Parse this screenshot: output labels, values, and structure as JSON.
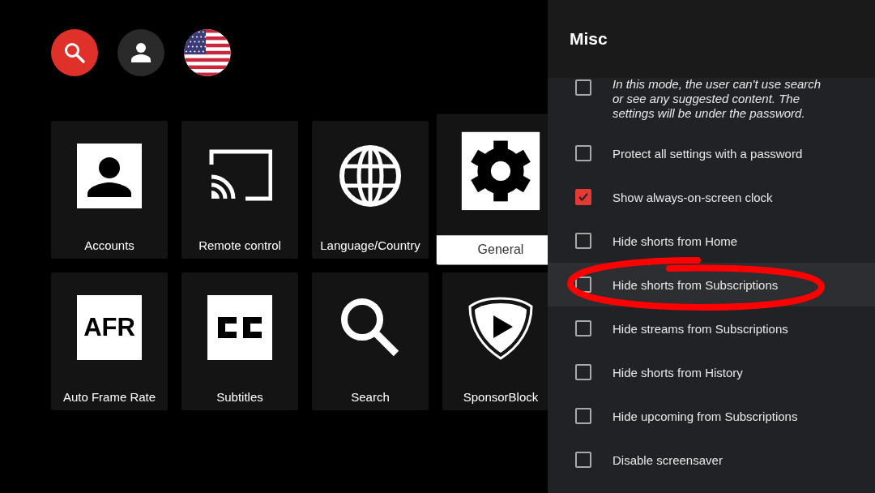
{
  "top_buttons": [
    {
      "kind": "search"
    },
    {
      "kind": "account"
    },
    {
      "kind": "flag"
    }
  ],
  "tiles": [
    {
      "label": "Accounts",
      "selected": false
    },
    {
      "label": "Remote control",
      "selected": false
    },
    {
      "label": "Language/Country",
      "selected": false
    },
    {
      "label": "General",
      "selected": true
    },
    {
      "label": "Auto Frame Rate",
      "badge": "AFR",
      "selected": false
    },
    {
      "label": "Subtitles",
      "selected": false
    },
    {
      "label": "Search",
      "selected": false
    },
    {
      "label": "SponsorBlock",
      "selected": false
    }
  ],
  "panel": {
    "title": "Misc",
    "items": [
      {
        "label": "In this mode, the user can't use search or see any suggested content. The settings will be under the password.",
        "kind": "description",
        "checked": false,
        "focused": false,
        "circled": false
      },
      {
        "label": "Protect all settings with a password",
        "checked": false,
        "focused": false,
        "circled": false
      },
      {
        "label": "Show always-on-screen clock",
        "checked": true,
        "focused": false,
        "circled": false
      },
      {
        "label": "Hide shorts from Home",
        "checked": false,
        "focused": false,
        "circled": false
      },
      {
        "label": "Hide shorts from Subscriptions",
        "checked": false,
        "focused": true,
        "circled": true
      },
      {
        "label": "Hide streams from Subscriptions",
        "checked": false,
        "focused": false,
        "circled": false
      },
      {
        "label": "Hide shorts from History",
        "checked": false,
        "focused": false,
        "circled": false
      },
      {
        "label": "Hide upcoming from Subscriptions",
        "checked": false,
        "focused": false,
        "circled": false
      },
      {
        "label": "Disable screensaver",
        "checked": false,
        "focused": false,
        "circled": false
      }
    ]
  }
}
